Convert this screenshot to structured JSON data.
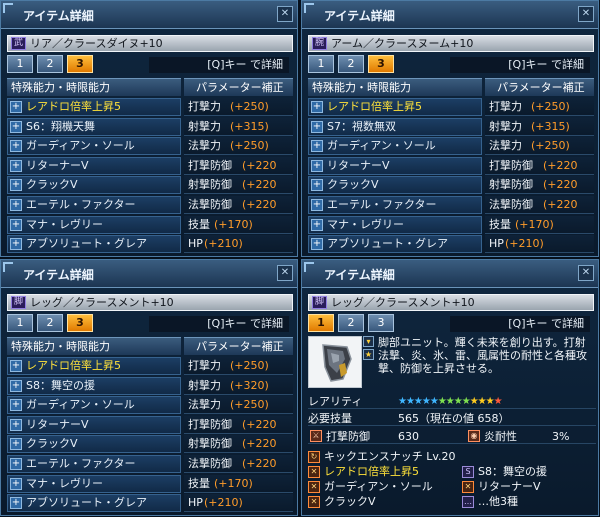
{
  "common": {
    "title": "アイテム詳細",
    "detail_hint": "[Q]キー で詳細",
    "tabs": [
      "1",
      "2",
      "3"
    ],
    "affix_header": "特殊能力・時限能力",
    "param_header": "パラメーター補正",
    "close_glyph": "✕"
  },
  "panel1": {
    "item_icon": "武",
    "item_name": "リア／クラースダイヌ+10",
    "active_tab": 3,
    "affixes": [
      "レアドロ倍率上昇5",
      "S6：翔機天舞",
      "ガーディアン・ソール",
      "リターナーV",
      "クラックV",
      "エーテル・ファクター",
      "マナ・レヴリー",
      "アブソリュート・グレア"
    ],
    "stats": [
      {
        "label": "打撃力",
        "value": "(+250)"
      },
      {
        "label": "射撃力",
        "value": "(+315)"
      },
      {
        "label": "法撃力",
        "value": "(+250)"
      },
      {
        "label": "打撃防御",
        "value": "(+220"
      },
      {
        "label": "射撃防御",
        "value": "(+220"
      },
      {
        "label": "法撃防御",
        "value": "(+220"
      },
      {
        "label": "技量",
        "value": "(+170)"
      },
      {
        "label": "HP",
        "value": "(+210)"
      }
    ]
  },
  "panel2": {
    "item_icon": "腕",
    "item_name": "アーム／クラースヌーム+10",
    "active_tab": 3,
    "affixes": [
      "レアドロ倍率上昇5",
      "S7：視数無双",
      "ガーディアン・ソール",
      "リターナーV",
      "クラックV",
      "エーテル・ファクター",
      "マナ・レヴリー",
      "アブソリュート・グレア"
    ],
    "stats": [
      {
        "label": "打撃力",
        "value": "(+250)"
      },
      {
        "label": "射撃力",
        "value": "(+315)"
      },
      {
        "label": "法撃力",
        "value": "(+250)"
      },
      {
        "label": "打撃防御",
        "value": "(+220"
      },
      {
        "label": "射撃防御",
        "value": "(+220"
      },
      {
        "label": "法撃防御",
        "value": "(+220"
      },
      {
        "label": "技量",
        "value": "(+170)"
      },
      {
        "label": "HP",
        "value": "(+210)"
      }
    ]
  },
  "panel3": {
    "item_icon": "脚",
    "item_name": "レッグ／クラースメント+10",
    "active_tab": 3,
    "affixes": [
      "レアドロ倍率上昇5",
      "S8：舞空の援",
      "ガーディアン・ソール",
      "リターナーV",
      "クラックV",
      "エーテル・ファクター",
      "マナ・レヴリー",
      "アブソリュート・グレア"
    ],
    "stats": [
      {
        "label": "打撃力",
        "value": "(+250)"
      },
      {
        "label": "射撃力",
        "value": "(+320)"
      },
      {
        "label": "法撃力",
        "value": "(+250)"
      },
      {
        "label": "打撃防御",
        "value": "(+220"
      },
      {
        "label": "射撃防御",
        "value": "(+220"
      },
      {
        "label": "法撃防御",
        "value": "(+220"
      },
      {
        "label": "技量",
        "value": "(+170)"
      },
      {
        "label": "HP",
        "value": "(+210)"
      }
    ]
  },
  "panel4": {
    "item_icon": "脚",
    "item_name": "レッグ／クラースメント+10",
    "active_tab": 1,
    "description": "脚部ユニット。輝く未来を創り出す。打射法撃、炎、氷、雷、風属性の耐性と各種攻撃、防御を上昇させる。",
    "rarity_label": "レアリティ",
    "stars": "★★★★★★★★★★★★★",
    "required_label": "必要技量",
    "required_value": "565（現在の値 658）",
    "def_label": "打撃防御",
    "def_value": "630",
    "res_label": "炎耐性",
    "res_value": "3%",
    "unit_ability": "キックエンスナッチ Lv.20",
    "abilities": [
      "レアドロ倍率上昇5",
      "S8：舞空の援",
      "ガーディアン・ソール",
      "リターナーV",
      "クラックV",
      "…他3種"
    ]
  }
}
